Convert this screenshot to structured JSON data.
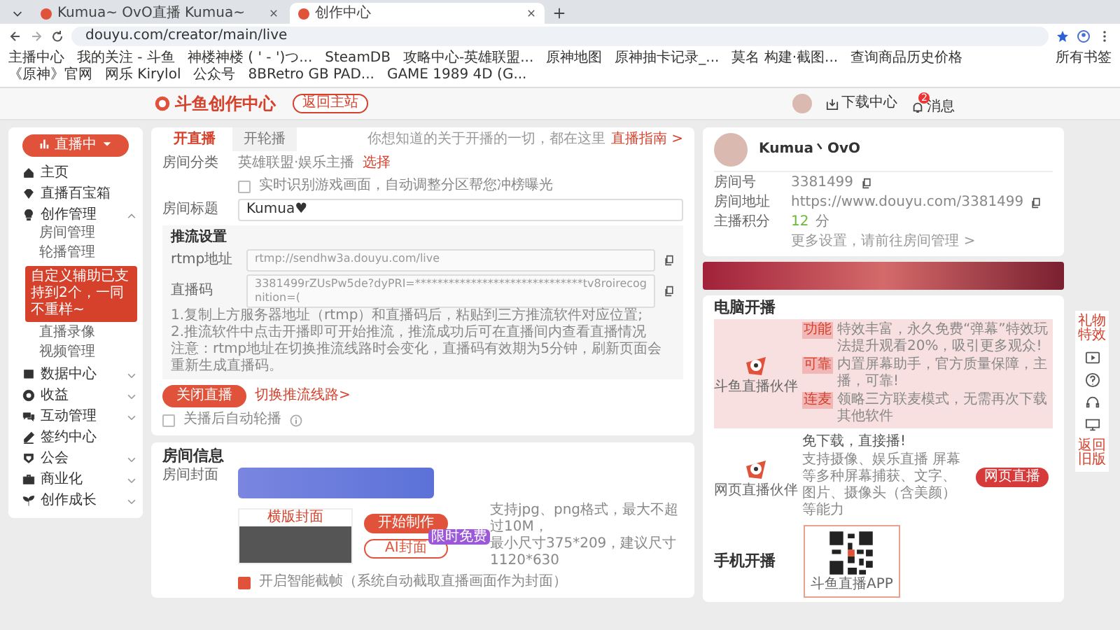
{
  "browser": {
    "tabs": [
      {
        "title": "Kumua~ OvO直播 Kumua~",
        "selected": false
      },
      {
        "title": "创作中心",
        "selected": true
      }
    ],
    "url": "douyu.com/creator/main/live",
    "bookmarks": [
      "主播中心",
      "我的关注 - 斗鱼",
      "神楼神楼 ( ' - ')つ...",
      "SteamDB",
      "攻略中心-英雄联盟...",
      "原神地图",
      "原神抽卡记录_...",
      "莫名 构建·截图...",
      "查询商品历史价格",
      "《原神》官网",
      "网乐 Kirylol",
      "公众号",
      "8BRetro GB PAD...",
      "GAME 1989 4D (G..."
    ],
    "all_bookmarks": "所有书签"
  },
  "header": {
    "logo": "斗鱼创作中心",
    "back_button": "返回主站",
    "download": "下载中心",
    "messages": "消息",
    "message_count": "2"
  },
  "sidebar": {
    "live_button": "直播中",
    "items": [
      {
        "label": "主页"
      },
      {
        "label": "直播百宝箱"
      },
      {
        "label": "创作管理",
        "expanded": true,
        "children": [
          {
            "label": "房间管理"
          },
          {
            "label": "轮播管理",
            "tooltip": "自定义辅助已支持到2个，一同不重样~"
          },
          {
            "label": "直播录像"
          },
          {
            "label": "视频管理"
          }
        ]
      },
      {
        "label": "数据中心",
        "expanded": false
      },
      {
        "label": "收益",
        "expanded": false
      },
      {
        "label": "互动管理",
        "expanded": false
      },
      {
        "label": "签约中心"
      },
      {
        "label": "公会",
        "expanded": false
      },
      {
        "label": "商业化",
        "expanded": false
      },
      {
        "label": "创作成长",
        "expanded": false
      }
    ]
  },
  "live": {
    "tabs": [
      {
        "label": "开直播",
        "selected": true
      },
      {
        "label": "开轮播",
        "selected": false
      }
    ],
    "hint": "你想知道的关于开播的一切，都在这里",
    "guide_link": "直播指南 >",
    "category_label": "房间分类",
    "category_value": "英雄联盟·娱乐主播",
    "category_action": "选择",
    "auto_category": {
      "label": "实时识别游戏画面，自动调整分区帮您冲榜曝光",
      "checked": false
    },
    "title_label": "房间标题",
    "title_value": "Kumua♥",
    "stream": {
      "heading": "推流设置",
      "fields": [
        {
          "label": "rtmp地址",
          "value": "rtmp://sendhw3a.douyu.com/live"
        },
        {
          "label": "直播码",
          "value": "3381499rZUsPw5de?dyPRI=******************************tv8roirecognition=("
        }
      ],
      "notes": [
        "1.复制上方服务器地址（rtmp）和直播码后，粘贴到三方推流软件对应位置;",
        "2.推流软件中点击开播即可开始推流，推流成功后可在直播间内查看直播情况",
        "注意：rtmp地址在切换推流线路时会变化，直播码有效期为5分钟，刷新页面会重新生成直播码。"
      ]
    },
    "close_button": "关闭直播",
    "switch_link": "切换推流线路>",
    "auto_rotate": {
      "label": "关播后自动轮播",
      "checked": false
    }
  },
  "room_info": {
    "heading": "房间信息",
    "cover_label": "房间封面",
    "cover_tag": "横版封面",
    "make_button": "开始制作",
    "ai_button": "AI封面",
    "ai_badge": "限时免费",
    "hints": [
      "支持jpg、png格式，最大不超过10M，",
      "最小尺寸375*209，建议尺寸1120*630"
    ],
    "smart_cover": {
      "label": "开启智能截帧（系统自动截取直播画面作为封面）",
      "checked": true
    }
  },
  "profile": {
    "name": "Kumua丶OvO",
    "rows": [
      {
        "label": "房间号",
        "value": "3381499"
      },
      {
        "label": "房间地址",
        "value": "https://www.douyu.com/3381499"
      }
    ],
    "score_label": "主播积分",
    "score": "12",
    "score_unit": "分",
    "more_link": "更多设置，请前往房间管理 >"
  },
  "pc": {
    "heading": "电脑开播",
    "apps": [
      {
        "kind": "client",
        "name": "斗鱼直播伙伴",
        "lines": [
          {
            "tag": "功能",
            "text": "特效丰富，永久免费“弹幕”特效玩法提升观看20%，吸引更多观众!"
          },
          {
            "tag": "可靠",
            "text": "内置屏幕助手，官方质量保障，主播，可靠!"
          },
          {
            "tag": "连麦",
            "text": "领略三方联麦模式，无需再次下载其他软件"
          }
        ]
      },
      {
        "kind": "web",
        "name": "网页直播伙伴",
        "title": "免下载，直接播!",
        "desc": "支持摄像、娱乐直播 屏幕等多种屏幕捕获、文字、图片、摄像头（含美颜）等能力",
        "button": "网页直播"
      }
    ]
  },
  "mobile": {
    "heading": "手机开播",
    "qr_caption": "斗鱼直播APP"
  },
  "float": {
    "top_label": "礼物特效",
    "bottom_label": "返回旧版"
  }
}
